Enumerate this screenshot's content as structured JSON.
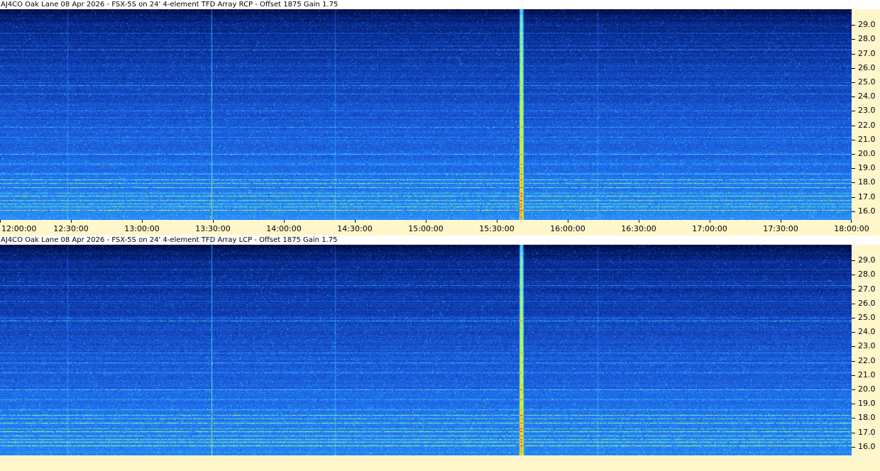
{
  "chart_data": [
    {
      "type": "heatmap",
      "title": "AJ4CO Oak Lane 08 Apr 2026 - FSX-5S on 24' 4-element TFD Array RCP  -  Offset 1875  Gain 1.75",
      "xlabel": "",
      "ylabel": "",
      "x_ticks": [
        "12:00:00",
        "12:30:00",
        "13:00:00",
        "13:30:00",
        "14:00:00",
        "14:30:00",
        "15:00:00",
        "15:30:00",
        "16:00:00",
        "16:30:00",
        "17:00:00",
        "17:30:00",
        "18:00:00"
      ],
      "y_ticks": [
        "16.0",
        "17.0",
        "18.0",
        "19.0",
        "20.0",
        "21.0",
        "22.0",
        "23.0",
        "24.0",
        "25.0",
        "26.0",
        "27.0",
        "28.0",
        "29.0"
      ],
      "xlim": [
        "12:00:00",
        "18:00:00"
      ],
      "ylim": [
        15.4,
        30.1
      ],
      "colormap": [
        "#000a3c",
        "#0a32a0",
        "#1e64e6",
        "#28a0ff",
        "#50dcff",
        "#b4ff50",
        "#ffe600",
        "#ff2864"
      ]
    },
    {
      "type": "heatmap",
      "title": "AJ4CO Oak Lane 08 Apr 2026 - FSX-5S on 24' 4-element TFD Array LCP  -  Offset 1875  Gain 1.75",
      "xlabel": "",
      "ylabel": "",
      "x_ticks": [],
      "y_ticks": [
        "16.0",
        "17.0",
        "18.0",
        "19.0",
        "20.0",
        "21.0",
        "22.0",
        "23.0",
        "24.0",
        "25.0",
        "26.0",
        "27.0",
        "28.0",
        "29.0"
      ],
      "xlim": [
        "12:00:00",
        "18:00:00"
      ],
      "ylim": [
        15.4,
        30.1
      ],
      "colormap": [
        "#000a3c",
        "#0a32a0",
        "#1e64e6",
        "#28a0ff",
        "#50dcff",
        "#b4ff50",
        "#ffe600",
        "#ff2864"
      ]
    }
  ],
  "colors": {
    "axis_background": "#fff6cc",
    "axis_text": "#000000"
  }
}
